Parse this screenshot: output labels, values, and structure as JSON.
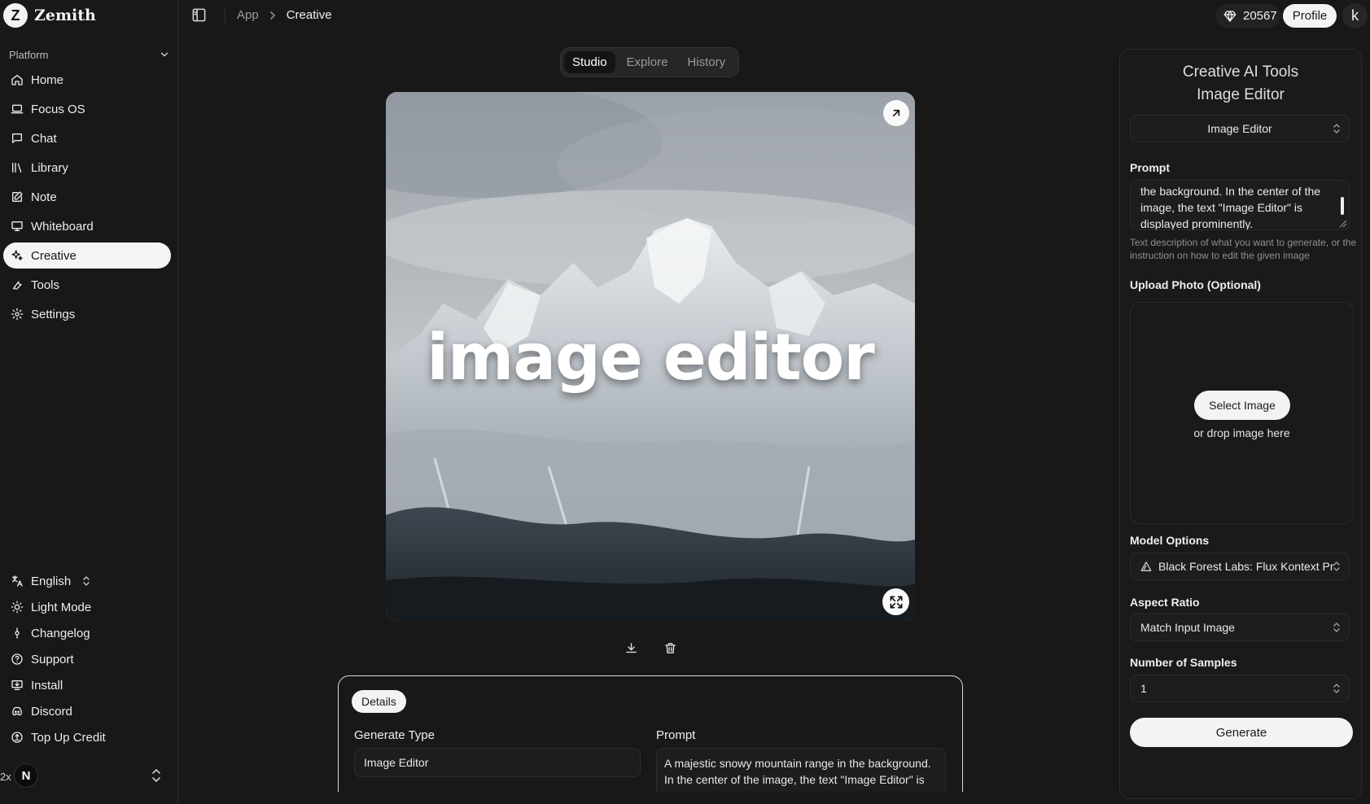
{
  "brand": {
    "name": "Zemith",
    "logo_letter": "Z"
  },
  "sidebar": {
    "section_label": "Platform",
    "items": [
      {
        "label": "Home",
        "icon": "home-icon"
      },
      {
        "label": "Focus OS",
        "icon": "laptop-icon"
      },
      {
        "label": "Chat",
        "icon": "chat-icon"
      },
      {
        "label": "Library",
        "icon": "library-icon"
      },
      {
        "label": "Note",
        "icon": "note-icon"
      },
      {
        "label": "Whiteboard",
        "icon": "whiteboard-icon"
      },
      {
        "label": "Creative",
        "icon": "sparkles-icon",
        "active": true
      },
      {
        "label": "Tools",
        "icon": "wrench-icon"
      },
      {
        "label": "Settings",
        "icon": "gear-icon"
      }
    ],
    "bottom_items": [
      {
        "label": "English",
        "icon": "translate-icon"
      },
      {
        "label": "Light Mode",
        "icon": "sun-icon"
      },
      {
        "label": "Changelog",
        "icon": "commit-icon"
      },
      {
        "label": "Support",
        "icon": "help-icon"
      },
      {
        "label": "Install",
        "icon": "install-icon"
      },
      {
        "label": "Discord",
        "icon": "discord-icon"
      },
      {
        "label": "Top Up Credit",
        "icon": "credit-icon"
      }
    ],
    "zoom_label": "2x",
    "avatar_letter": "N"
  },
  "topbar": {
    "breadcrumb": {
      "app": "App",
      "current": "Creative"
    },
    "credits": "20567",
    "profile_label": "Profile",
    "user_initial": "k"
  },
  "mode_tabs": [
    {
      "label": "Studio",
      "active": true
    },
    {
      "label": "Explore",
      "active": false
    },
    {
      "label": "History",
      "active": false
    }
  ],
  "image": {
    "overlay_text": "image editor"
  },
  "details": {
    "tab_label": "Details",
    "generate_type_label": "Generate Type",
    "generate_type_value": "Image Editor",
    "prompt_label": "Prompt",
    "prompt_value": "A majestic snowy mountain range in the background. In the center of the image, the text \"Image Editor\" is displayed prominently."
  },
  "right_panel": {
    "title_line1": "Creative AI Tools",
    "title_line2": "Image Editor",
    "tool_select": "Image Editor",
    "prompt_label": "Prompt",
    "prompt_value": "the background. In the center of the image, the text \"Image Editor\" is displayed prominently.",
    "prompt_hint": "Text description of what you want to generate, or the instruction on how to edit the given image",
    "upload_label": "Upload Photo (Optional)",
    "select_image_label": "Select Image",
    "drop_hint": "or drop image here",
    "model_label": "Model Options",
    "model_value": "Black Forest Labs: Flux Kontext Pr",
    "aspect_label": "Aspect Ratio",
    "aspect_value": "Match Input Image",
    "samples_label": "Number of Samples",
    "samples_value": "1",
    "generate_label": "Generate"
  }
}
